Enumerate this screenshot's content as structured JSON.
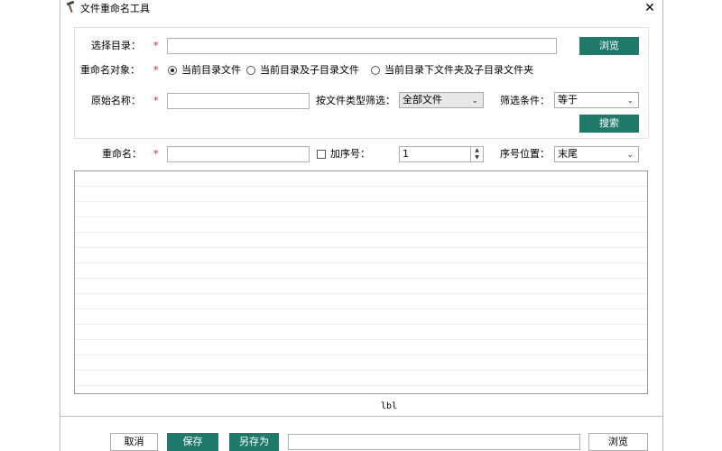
{
  "window": {
    "title": "文件重命名工具",
    "close_glyph": "✕"
  },
  "form": {
    "dir_label": "选择目录：",
    "dir_value": "",
    "browse_label": "浏览",
    "target_label": "重命名对象：",
    "radios": [
      {
        "label": "当前目录文件",
        "selected": true
      },
      {
        "label": "当前目录及子目录文件",
        "selected": false
      },
      {
        "label": "当前目录下文件夹及子目录文件夹",
        "selected": false
      }
    ],
    "orig_name_label": "原始名称：",
    "orig_name_value": "",
    "type_filter_label": "按文件类型筛选：",
    "type_filter_value": "全部文件",
    "condition_label": "筛选条件：",
    "condition_value": "等于",
    "search_label": "搜索",
    "required_mark": "*"
  },
  "rename": {
    "label": "重命名：",
    "value": "",
    "add_seq_label": "加序号：",
    "add_seq_checked": false,
    "seq_value": "1",
    "seq_pos_label": "序号位置：",
    "seq_pos_value": "末尾"
  },
  "list": {
    "status_text": "lbl"
  },
  "footer": {
    "cancel_label": "取消",
    "save_label": "保存",
    "save_as_label": "另存为",
    "path_value": "",
    "browse_label": "浏览"
  },
  "colors": {
    "accent": "#1f7a6b",
    "required": "#d02020"
  },
  "icons": {
    "app": "hammer-icon",
    "close": "close-icon",
    "dropdown": "chevron-down-icon"
  }
}
